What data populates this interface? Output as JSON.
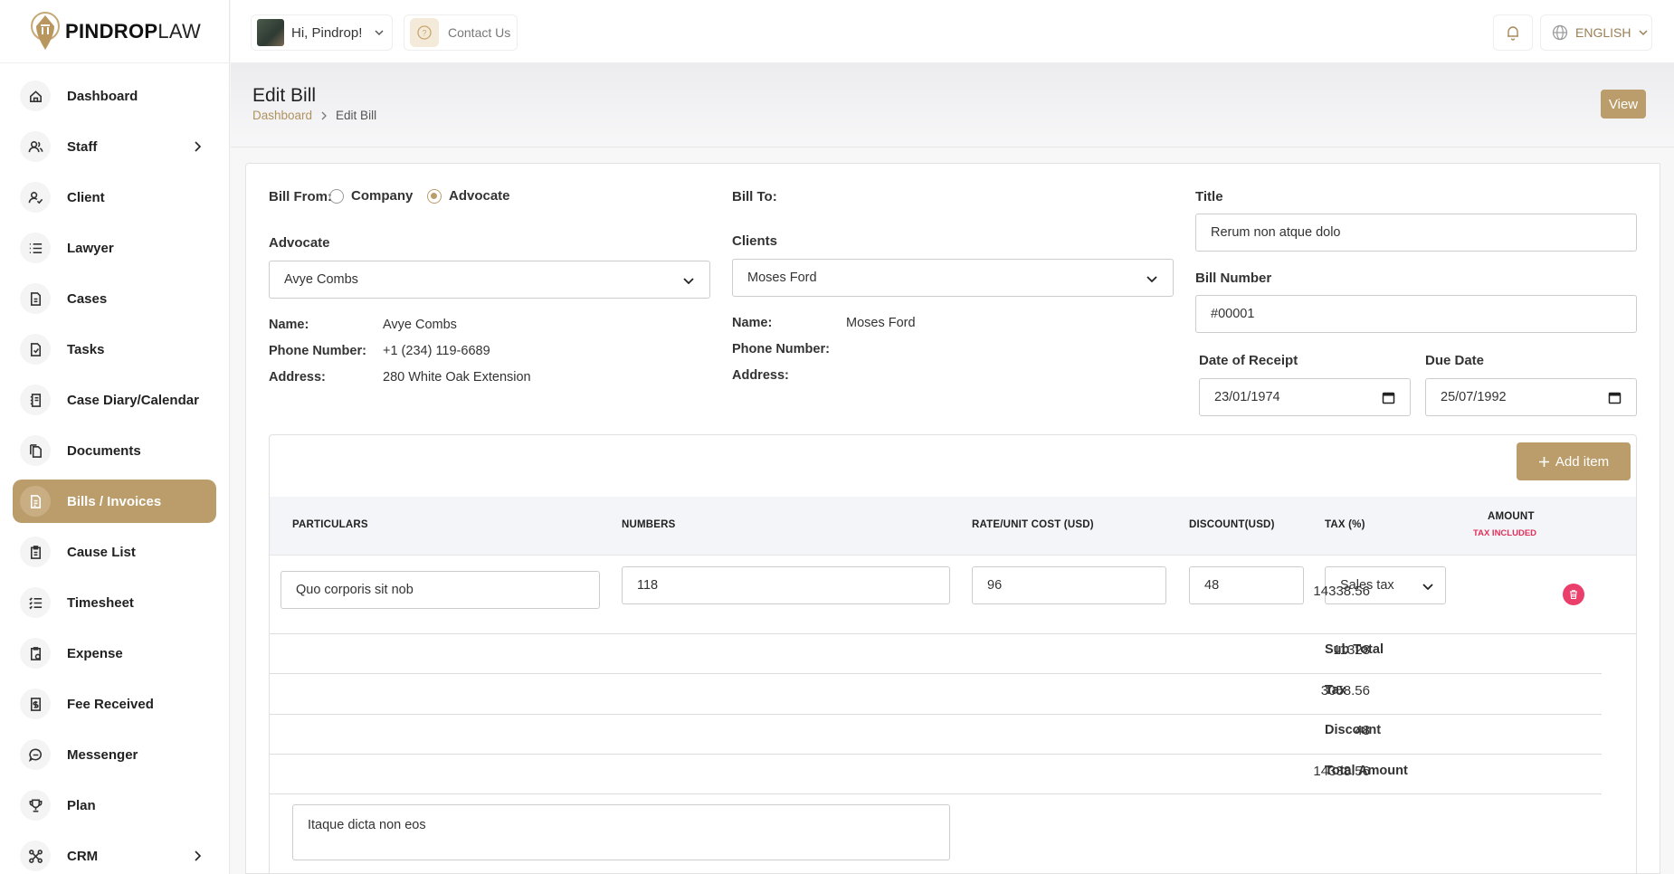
{
  "brand": {
    "bold": "PINDROP",
    "light": "LAW"
  },
  "sidebar": {
    "items": [
      {
        "label": "Dashboard",
        "icon": "home-icon"
      },
      {
        "label": "Staff",
        "icon": "users-icon",
        "has_children": true
      },
      {
        "label": "Client",
        "icon": "user-check-icon"
      },
      {
        "label": "Lawyer",
        "icon": "list-icon"
      },
      {
        "label": "Cases",
        "icon": "file-icon"
      },
      {
        "label": "Tasks",
        "icon": "task-icon"
      },
      {
        "label": "Case Diary/Calendar",
        "icon": "diary-icon"
      },
      {
        "label": "Documents",
        "icon": "documents-icon"
      },
      {
        "label": "Bills / Invoices",
        "icon": "invoice-icon",
        "active": true
      },
      {
        "label": "Cause List",
        "icon": "clipboard-icon"
      },
      {
        "label": "Timesheet",
        "icon": "timesheet-icon"
      },
      {
        "label": "Expense",
        "icon": "expense-icon"
      },
      {
        "label": "Fee Received",
        "icon": "fee-icon"
      },
      {
        "label": "Messenger",
        "icon": "chat-icon"
      },
      {
        "label": "Plan",
        "icon": "trophy-icon"
      },
      {
        "label": "CRM",
        "icon": "crm-icon",
        "has_children": true
      }
    ]
  },
  "topbar": {
    "greeting": "Hi, Pindrop!",
    "contact": "Contact Us",
    "language": "ENGLISH"
  },
  "header": {
    "title": "Edit Bill",
    "breadcrumb": [
      "Dashboard",
      "Edit Bill"
    ],
    "view_label": "View"
  },
  "form": {
    "bill_from_label": "Bill From:",
    "bill_from_options": [
      "Company",
      "Advocate"
    ],
    "bill_from_selected": "Advocate",
    "bill_to_label": "Bill To:",
    "advocate_label": "Advocate",
    "advocate_value": "Avye Combs",
    "advocate_info": {
      "name_k": "Name:",
      "name_v": "Avye Combs",
      "phone_k": "Phone Number:",
      "phone_v": "+1 (234) 119-6689",
      "address_k": "Address:",
      "address_v": "280 White Oak Extension"
    },
    "clients_label": "Clients",
    "clients_value": "Moses Ford",
    "client_info": {
      "name_k": "Name:",
      "name_v": "Moses Ford",
      "phone_k": "Phone Number:",
      "address_k": "Address:"
    },
    "title_label": "Title",
    "title_value": "Rerum non atque dolo",
    "bill_number_label": "Bill Number",
    "bill_number_value": "#00001",
    "date_receipt_label": "Date of Receipt",
    "date_receipt_value": "23/01/1974",
    "due_date_label": "Due Date",
    "due_date_value": "25/07/1992"
  },
  "items": {
    "add_label": "Add item",
    "headers": {
      "particulars": "PARTICULARS",
      "numbers": "NUMBERS",
      "rate": "RATE/UNIT COST (USD)",
      "discount": "DISCOUNT(USD)",
      "tax": "TAX (%)",
      "amount": "AMOUNT",
      "amount_sub": "TAX INCLUDED"
    },
    "rows": [
      {
        "particulars": "Quo corporis sit nob",
        "numbers": "118",
        "rate": "96",
        "discount": "48",
        "tax": "Sales tax",
        "amount": "14338.56"
      }
    ],
    "summary": {
      "subtotal_k": "Sub Total",
      "subtotal_v": "11328",
      "tax_k": "Tax",
      "tax_v": "3058.56",
      "discount_k": "Discount",
      "discount_v": "48",
      "total_k": "Total Amount",
      "total_v": "14338.56"
    },
    "notes": "Itaque dicta non eos"
  },
  "colors": {
    "accent": "#bb9d6b",
    "danger": "#ea3e6b",
    "tax_included": "#e0305a"
  }
}
